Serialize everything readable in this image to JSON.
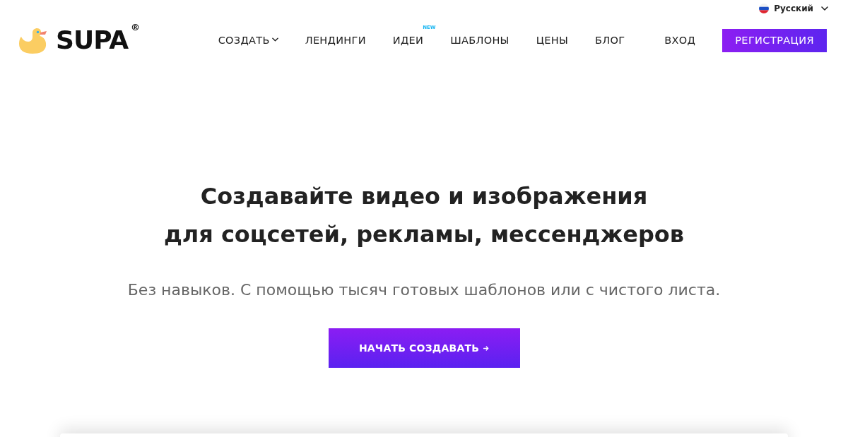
{
  "language_selector": {
    "label": "Русский"
  },
  "logo": {
    "name": "SUPA",
    "mark": "®"
  },
  "nav": {
    "items": [
      {
        "label": "СОЗДАТЬ",
        "kind": "dropdown"
      },
      {
        "label": "ЛЕНДИНГИ",
        "kind": "link"
      },
      {
        "label": "ИДЕИ",
        "kind": "link",
        "badge": "NEW"
      },
      {
        "label": "ШАБЛОНЫ",
        "kind": "link"
      },
      {
        "label": "ЦЕНЫ",
        "kind": "link"
      },
      {
        "label": "БЛОГ",
        "kind": "link"
      }
    ],
    "login": "ВХОД",
    "signup": "РЕГИСТРАЦИЯ"
  },
  "hero": {
    "title_lines": [
      "Создавайте видео и изображения",
      "для соцсетей, рекламы, мессенджеров"
    ],
    "subtitle": "Без навыков. С помощью тысяч готовых шаблонов или с чистого листа.",
    "cta": "НАЧАТЬ СОЗДАВАТЬ"
  }
}
